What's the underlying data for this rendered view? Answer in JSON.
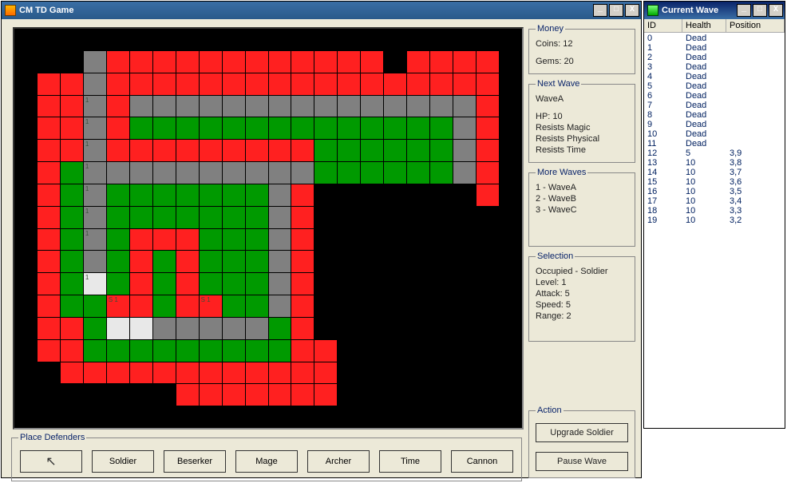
{
  "main": {
    "title": "CM TD Game",
    "money": {
      "legend": "Money",
      "coins_label": "Coins: 12",
      "gems_label": "Gems: 20"
    },
    "nextwave": {
      "legend": "Next Wave",
      "name": "WaveA",
      "hp": "HP: 10",
      "r1": "Resists Magic",
      "r2": "Resists Physical",
      "r3": "Resists Time"
    },
    "morewaves": {
      "legend": "More Waves",
      "w1": "1 - WaveA",
      "w2": "2 - WaveB",
      "w3": "3 - WaveC"
    },
    "selection": {
      "legend": "Selection",
      "occ": "Occupied - Soldier",
      "lvl": "Level: 1",
      "atk": "Attack: 5",
      "spd": "Speed: 5",
      "rng": "Range: 2"
    },
    "action": {
      "legend": "Action",
      "upgrade": "Upgrade Soldier",
      "pause": "Pause Wave"
    },
    "place": {
      "legend": "Place Defenders",
      "btns": [
        "",
        "Soldier",
        "Beserker",
        "Mage",
        "Archer",
        "Time",
        "Cannon"
      ]
    }
  },
  "wave": {
    "title": "Current Wave",
    "cols": [
      "ID",
      "Health",
      "Position"
    ],
    "rows": [
      {
        "id": "0",
        "h": "Dead",
        "p": ""
      },
      {
        "id": "1",
        "h": "Dead",
        "p": ""
      },
      {
        "id": "2",
        "h": "Dead",
        "p": ""
      },
      {
        "id": "3",
        "h": "Dead",
        "p": ""
      },
      {
        "id": "4",
        "h": "Dead",
        "p": ""
      },
      {
        "id": "5",
        "h": "Dead",
        "p": ""
      },
      {
        "id": "6",
        "h": "Dead",
        "p": ""
      },
      {
        "id": "7",
        "h": "Dead",
        "p": ""
      },
      {
        "id": "8",
        "h": "Dead",
        "p": ""
      },
      {
        "id": "9",
        "h": "Dead",
        "p": ""
      },
      {
        "id": "10",
        "h": "Dead",
        "p": ""
      },
      {
        "id": "11",
        "h": "Dead",
        "p": ""
      },
      {
        "id": "12",
        "h": "5",
        "p": "3,9"
      },
      {
        "id": "13",
        "h": "10",
        "p": "3,8"
      },
      {
        "id": "14",
        "h": "10",
        "p": "3,7"
      },
      {
        "id": "15",
        "h": "10",
        "p": "3,6"
      },
      {
        "id": "16",
        "h": "10",
        "p": "3,5"
      },
      {
        "id": "17",
        "h": "10",
        "p": "3,4"
      },
      {
        "id": "18",
        "h": "10",
        "p": "3,3"
      },
      {
        "id": "19",
        "h": "10",
        "p": "3,2"
      }
    ]
  },
  "grid": {
    "rows": [
      "kkkkkkkkkkkkkkkkkkkkkk",
      "kkkgrrrrrrrrrrrrkrrrrk",
      "krrgrrrrrrrrrrrrrrrrrk",
      "krrgrgggggggggggggggrk",
      "krrgrnnnnnnnnnnnnnngrk",
      "krrgrrrrrrrrrnnnnnngrk",
      "krnggggggggggnnnnnngrk",
      "krngnnnnnnngrkkkkkkkrk",
      "krngnnnnnnngrkkkkkkkkk",
      "krngnrrrnnngrkkkkkkkkk",
      "krngnrnrnnngrkkkkkkkkk",
      "krnwnrnrnnngrkkkkkkkkk",
      "krnnrrnrrnngrkkkkkkkkk",
      "krrnwwgggggnrkkkkkkkkk",
      "krrnnnnnnnnnrrkkkkkkkk",
      "kkrrrrrrrrrrrrkkkkkkkk",
      "kkkkkkkrrrrrrrkkkkkkkk",
      "kkkkkkkkkkkkkkkkkkkkkk"
    ],
    "texts": {
      "3,3": "1",
      "4,3": "1",
      "5,3": "1",
      "6,3": "1",
      "7,3": "1",
      "8,3": "1",
      "9,3": "1",
      "11,3": "1",
      "12,4": "S 1",
      "12,8": "S 1"
    }
  }
}
